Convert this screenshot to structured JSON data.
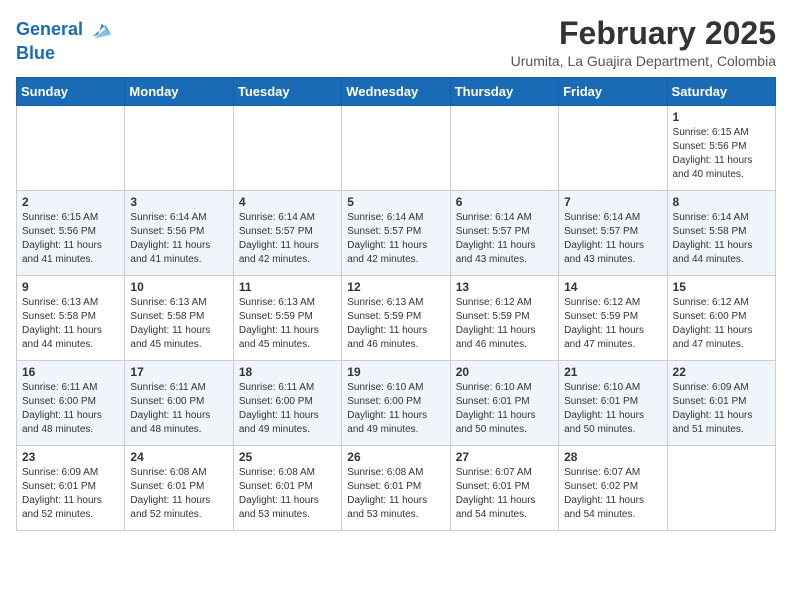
{
  "header": {
    "logo_line1": "General",
    "logo_line2": "Blue",
    "month_year": "February 2025",
    "location": "Urumita, La Guajira Department, Colombia"
  },
  "weekdays": [
    "Sunday",
    "Monday",
    "Tuesday",
    "Wednesday",
    "Thursday",
    "Friday",
    "Saturday"
  ],
  "weeks": [
    [
      {
        "day": "",
        "info": ""
      },
      {
        "day": "",
        "info": ""
      },
      {
        "day": "",
        "info": ""
      },
      {
        "day": "",
        "info": ""
      },
      {
        "day": "",
        "info": ""
      },
      {
        "day": "",
        "info": ""
      },
      {
        "day": "1",
        "info": "Sunrise: 6:15 AM\nSunset: 5:56 PM\nDaylight: 11 hours\nand 40 minutes."
      }
    ],
    [
      {
        "day": "2",
        "info": "Sunrise: 6:15 AM\nSunset: 5:56 PM\nDaylight: 11 hours\nand 41 minutes."
      },
      {
        "day": "3",
        "info": "Sunrise: 6:14 AM\nSunset: 5:56 PM\nDaylight: 11 hours\nand 41 minutes."
      },
      {
        "day": "4",
        "info": "Sunrise: 6:14 AM\nSunset: 5:57 PM\nDaylight: 11 hours\nand 42 minutes."
      },
      {
        "day": "5",
        "info": "Sunrise: 6:14 AM\nSunset: 5:57 PM\nDaylight: 11 hours\nand 42 minutes."
      },
      {
        "day": "6",
        "info": "Sunrise: 6:14 AM\nSunset: 5:57 PM\nDaylight: 11 hours\nand 43 minutes."
      },
      {
        "day": "7",
        "info": "Sunrise: 6:14 AM\nSunset: 5:57 PM\nDaylight: 11 hours\nand 43 minutes."
      },
      {
        "day": "8",
        "info": "Sunrise: 6:14 AM\nSunset: 5:58 PM\nDaylight: 11 hours\nand 44 minutes."
      }
    ],
    [
      {
        "day": "9",
        "info": "Sunrise: 6:13 AM\nSunset: 5:58 PM\nDaylight: 11 hours\nand 44 minutes."
      },
      {
        "day": "10",
        "info": "Sunrise: 6:13 AM\nSunset: 5:58 PM\nDaylight: 11 hours\nand 45 minutes."
      },
      {
        "day": "11",
        "info": "Sunrise: 6:13 AM\nSunset: 5:59 PM\nDaylight: 11 hours\nand 45 minutes."
      },
      {
        "day": "12",
        "info": "Sunrise: 6:13 AM\nSunset: 5:59 PM\nDaylight: 11 hours\nand 46 minutes."
      },
      {
        "day": "13",
        "info": "Sunrise: 6:12 AM\nSunset: 5:59 PM\nDaylight: 11 hours\nand 46 minutes."
      },
      {
        "day": "14",
        "info": "Sunrise: 6:12 AM\nSunset: 5:59 PM\nDaylight: 11 hours\nand 47 minutes."
      },
      {
        "day": "15",
        "info": "Sunrise: 6:12 AM\nSunset: 6:00 PM\nDaylight: 11 hours\nand 47 minutes."
      }
    ],
    [
      {
        "day": "16",
        "info": "Sunrise: 6:11 AM\nSunset: 6:00 PM\nDaylight: 11 hours\nand 48 minutes."
      },
      {
        "day": "17",
        "info": "Sunrise: 6:11 AM\nSunset: 6:00 PM\nDaylight: 11 hours\nand 48 minutes."
      },
      {
        "day": "18",
        "info": "Sunrise: 6:11 AM\nSunset: 6:00 PM\nDaylight: 11 hours\nand 49 minutes."
      },
      {
        "day": "19",
        "info": "Sunrise: 6:10 AM\nSunset: 6:00 PM\nDaylight: 11 hours\nand 49 minutes."
      },
      {
        "day": "20",
        "info": "Sunrise: 6:10 AM\nSunset: 6:01 PM\nDaylight: 11 hours\nand 50 minutes."
      },
      {
        "day": "21",
        "info": "Sunrise: 6:10 AM\nSunset: 6:01 PM\nDaylight: 11 hours\nand 50 minutes."
      },
      {
        "day": "22",
        "info": "Sunrise: 6:09 AM\nSunset: 6:01 PM\nDaylight: 11 hours\nand 51 minutes."
      }
    ],
    [
      {
        "day": "23",
        "info": "Sunrise: 6:09 AM\nSunset: 6:01 PM\nDaylight: 11 hours\nand 52 minutes."
      },
      {
        "day": "24",
        "info": "Sunrise: 6:08 AM\nSunset: 6:01 PM\nDaylight: 11 hours\nand 52 minutes."
      },
      {
        "day": "25",
        "info": "Sunrise: 6:08 AM\nSunset: 6:01 PM\nDaylight: 11 hours\nand 53 minutes."
      },
      {
        "day": "26",
        "info": "Sunrise: 6:08 AM\nSunset: 6:01 PM\nDaylight: 11 hours\nand 53 minutes."
      },
      {
        "day": "27",
        "info": "Sunrise: 6:07 AM\nSunset: 6:01 PM\nDaylight: 11 hours\nand 54 minutes."
      },
      {
        "day": "28",
        "info": "Sunrise: 6:07 AM\nSunset: 6:02 PM\nDaylight: 11 hours\nand 54 minutes."
      },
      {
        "day": "",
        "info": ""
      }
    ]
  ]
}
